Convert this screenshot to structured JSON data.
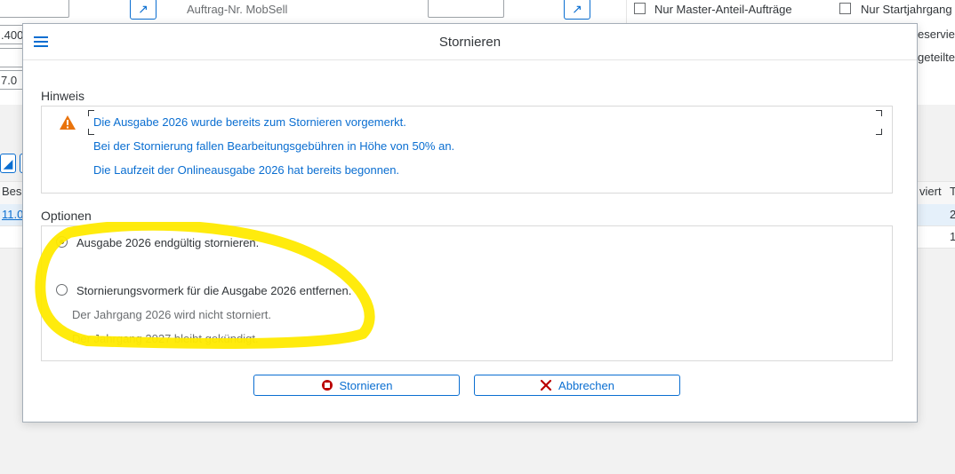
{
  "background": {
    "field_truncated_1": ".400",
    "field_truncated_2": "7.0",
    "auftrag_label": "Auftrag-Nr. MobSell",
    "checkbox_master_label": "Nur Master-Anteil-Aufträge",
    "checkbox_start_label": "Nur Startjahrgang",
    "right_text_1": "eservie",
    "right_text_2": "geteilte",
    "table_col_bes": "Bes",
    "table_col_viert": "viert",
    "table_col_t": "T",
    "row1_link": "11.0",
    "row1_right": "2",
    "row2_right": "1"
  },
  "dialog": {
    "title": "Stornieren",
    "hint_section_title": "Hinweis",
    "hint_lines": [
      "Die Ausgabe 2026 wurde bereits zum Stornieren vorgemerkt.",
      "Bei der Stornierung fallen Bearbeitungsgebühren in Höhe von 50% an.",
      "Die Laufzeit der Onlineausgabe 2026 hat bereits begonnen."
    ],
    "options_section_title": "Optionen",
    "option_1_label": "Ausgabe 2026 endgültig stornieren.",
    "option_2_label": "Stornierungsvormerk für die Ausgabe 2026 entfernen.",
    "option_2_note_1": "Der Jahrgang 2026 wird nicht storniert.",
    "option_2_note_2": "Der Jahrgang 2027 bleibt gekündigt.",
    "selected_option": 1,
    "btn_cancel_order": "Stornieren",
    "btn_abort": "Abbrechen"
  },
  "colors": {
    "accent": "#0a6ed1",
    "warning": "#e9730c",
    "danger": "#bb0000",
    "highlight": "#ffea00"
  }
}
